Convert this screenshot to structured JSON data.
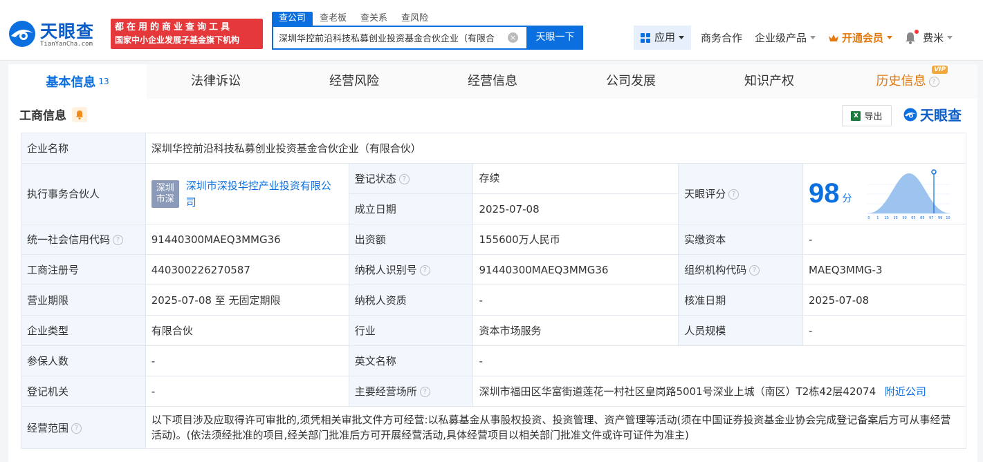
{
  "header": {
    "logo_text": "天眼查",
    "logo_sub": "TianYanCha.com",
    "promo_line1": "都在用的商业查询工具",
    "promo_line2": "国家中小企业发展子基金旗下机构",
    "search_tabs": [
      "查公司",
      "查老板",
      "查关系",
      "查风险"
    ],
    "search_value": "深圳华控前沿科技私募创业投资基金合伙企业（有限合",
    "search_button": "天眼一下",
    "nav": {
      "apps": "应用",
      "business": "商务合作",
      "enterprise": "企业级产品",
      "vip": "开通会员",
      "user": "费米"
    }
  },
  "tabs": [
    {
      "label": "基本信息",
      "count": "13"
    },
    {
      "label": "法律诉讼"
    },
    {
      "label": "经营风险"
    },
    {
      "label": "经营信息"
    },
    {
      "label": "公司发展"
    },
    {
      "label": "知识产权"
    },
    {
      "label": "历史信息",
      "tag": "VIP"
    }
  ],
  "section": {
    "title": "工商信息",
    "export": "导出",
    "brand": "天眼查"
  },
  "info": {
    "company_name_label": "企业名称",
    "company_name": "深圳华控前沿科技私募创业投资基金合伙企业（有限合伙）",
    "partner_label": "执行事务合伙人",
    "partner_badge_l1": "深圳",
    "partner_badge_l2": "市深",
    "partner_name": "深圳市深投华控产业投资有限公司",
    "reg_status_label": "登记状态",
    "reg_status": "存续",
    "established_label": "成立日期",
    "established": "2025-07-08",
    "score_label": "天眼评分",
    "score": "98",
    "score_unit": "分",
    "credit_code_label": "统一社会信用代码",
    "credit_code": "91440300MAEQ3MMG36",
    "capital_label": "出资额",
    "capital": "155600万人民币",
    "paid_capital_label": "实缴资本",
    "paid_capital": "-",
    "reg_no_label": "工商注册号",
    "reg_no": "440300226270587",
    "taxpayer_id_label": "纳税人识别号",
    "taxpayer_id": "91440300MAEQ3MMG36",
    "org_code_label": "组织机构代码",
    "org_code": "MAEQ3MMG-3",
    "term_label": "营业期限",
    "term": "2025-07-08 至 无固定期限",
    "taxpayer_qual_label": "纳税人资质",
    "taxpayer_qual": "-",
    "approval_date_label": "核准日期",
    "approval_date": "2025-07-08",
    "type_label": "企业类型",
    "type": "有限合伙",
    "industry_label": "行业",
    "industry": "资本市场服务",
    "staff_label": "人员规模",
    "staff": "-",
    "insured_label": "参保人数",
    "insured": "-",
    "english_name_label": "英文名称",
    "english_name": "-",
    "authority_label": "登记机关",
    "authority": "-",
    "address_label": "主要经营场所",
    "address": "深圳市福田区华富街道莲花一村社区皇岗路5001号深业上城（南区）T2栋42层42074",
    "nearby": "附近公司",
    "scope_label": "经营范围",
    "scope": "以下项目涉及应取得许可审批的,须凭相关审批文件方可经营:以私募基金从事股权投资、投资管理、资产管理等活动(须在中国证券投资基金业协会完成登记备案后方可从事经营活动)。(依法须经批准的项目,经关部门批准后方可开展经营活动,具体经营项目以相关部门批准文件或许可证件为准主)"
  },
  "score_chart_ticks": [
    "0",
    "1",
    "15",
    "35",
    "50",
    "65",
    "85",
    "97",
    "99",
    "100"
  ],
  "colors": {
    "accent": "#0b6fe0",
    "vip": "#e4780c",
    "status_green": "#2da44e",
    "promo_red": "#e5383b"
  }
}
